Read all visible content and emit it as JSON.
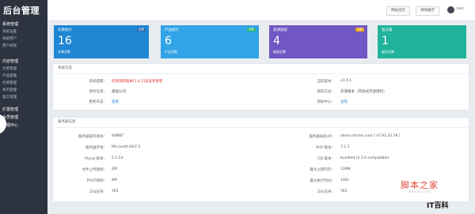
{
  "sidebar": {
    "brand": "后台管理",
    "groups": [
      {
        "label": "系统管理",
        "items": [
          "系统设置",
          "系统用户",
          "用户权限"
        ]
      },
      {
        "label": "内容管理",
        "items": [
          "文章管理",
          "产品管理",
          "栏目管理",
          "单页管理",
          "留言管理"
        ]
      },
      {
        "label": "扩展管理",
        "items": []
      },
      {
        "label": "会员管理",
        "items": []
      },
      {
        "label": "主题中心",
        "items": []
      }
    ]
  },
  "topbar": {
    "home_btn": "网站首页",
    "cache_btn": "清除缓存",
    "user": "test"
  },
  "cards": [
    {
      "title": "文章统计",
      "badge": "全部",
      "value": "16",
      "sub": "文章总数",
      "color": "#1f86d4",
      "badge_color": "#2b6fb0"
    },
    {
      "title": "产品统计",
      "badge": "全部",
      "value": "6",
      "sub": "产品总数",
      "color": "#31a3e6",
      "badge_color": "#2bb673"
    },
    {
      "title": "友情链接",
      "badge": "全部",
      "value": "4",
      "sub": "链接总数",
      "color": "#7057c3",
      "badge_color": "#e8a316"
    },
    {
      "title": "留言板",
      "badge": "",
      "value": "1",
      "sub": "留言总数",
      "color": "#20b39c",
      "badge_color": "#20b39c"
    }
  ],
  "system": {
    "header": "系统信息",
    "rows": [
      {
        "k": "系统提醒：",
        "v": "检测到新版本[1.4.2]未安装更新",
        "k2": "当前版本：",
        "v2": "v1.4.1"
      },
      {
        "k": "授权信息：",
        "v": "基础公司",
        "k2": "授权方式：",
        "v2": "开源版本（开放式开放授权）"
      },
      {
        "k": "更新日志：",
        "v": "查看",
        "k2": "帮助中心：",
        "v2": "查看"
      }
    ]
  },
  "server": {
    "header": "服务器信息",
    "rows": [
      {
        "k": "服务器操作系统：",
        "v": "WINNT",
        "k2": "服务器域名/IP：",
        "v2": "demo.mtcms.com [ 47.93.32.78 ]"
      },
      {
        "k": "服务器环境：",
        "v": "Microsoft-IIS/7.5",
        "k2": "PHP 版本：",
        "v2": "7.2.1"
      },
      {
        "k": "Mysql 版本：",
        "v": "5.5.53",
        "k2": "GD 版本：",
        "v2": "bundled (2.1.0 compatible)"
      },
      {
        "k": "文件上传限制：",
        "v": "2M",
        "k2": "最大占用内存：",
        "v2": "128M"
      },
      {
        "k": "POST限制：",
        "v": "8M",
        "k2": "最大执行时间：",
        "v2": "100s"
      },
      {
        "k": "Zlib支持：",
        "v": "YES",
        "k2": "Zlib支持：",
        "v2": "YES"
      }
    ]
  },
  "watermark": {
    "title": "脚本之家",
    "url": "www.jb51.net",
    "brand": "IT百科"
  }
}
